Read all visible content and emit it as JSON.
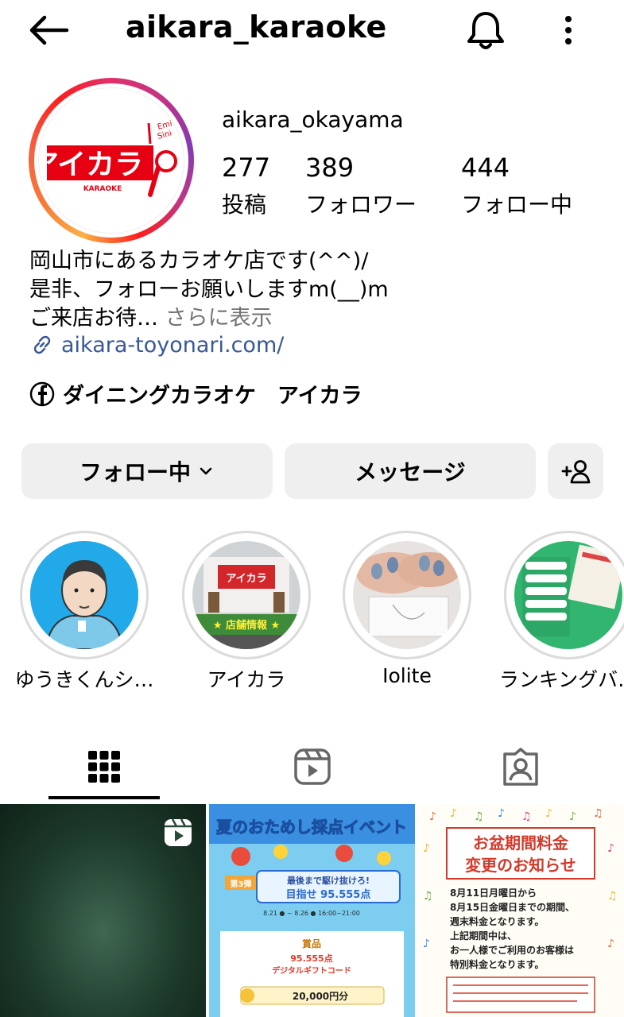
{
  "header": {
    "title": "aikara_karaoke",
    "back_icon": "arrow-left-icon",
    "bell_icon": "bell-icon",
    "more_icon": "more-vertical-icon"
  },
  "profile": {
    "avatar_logo_text": "アイカラ",
    "avatar_logo_sub": "KARAOKE",
    "display_name": "aikara_okayama",
    "stats": [
      {
        "num": "277",
        "label": "投稿"
      },
      {
        "num": "389",
        "label": "フォロワー"
      },
      {
        "num": "444",
        "label": "フォロー中"
      }
    ],
    "bio_line1": "岡山市にあるカラオケ店です(^^)/",
    "bio_line2": "是非、フォローお願いしますm(__)m",
    "bio_line3": "ご来店お待…",
    "bio_more": " さらに表示",
    "link": "aikara-toyonari.com/",
    "facebook": "ダイニングカラオケ　アイカラ"
  },
  "buttons": {
    "following": "フォロー中",
    "message": "メッセージ"
  },
  "highlights": [
    {
      "label": "ゆうきくんシ…"
    },
    {
      "label": "アイカラ",
      "sub": "★ 店舗情報 ★"
    },
    {
      "label": "Iolite"
    },
    {
      "label": "ランキングバ…"
    }
  ],
  "tabs": [
    "grid-icon",
    "reels-icon",
    "tagged-icon"
  ],
  "posts": [
    {
      "type": "reel"
    },
    {
      "title": "夏のおためし採点イベント",
      "badge": "第3弾",
      "headline": "最後まで駆け抜けろ!",
      "target": "目指せ 95.555点",
      "dates": "8.21 ● ~ 8.26 ● 16:00~21:00",
      "prize_title": "賞品",
      "prize_text": "95.555点",
      "gift": "デジタルギフトコード",
      "amount": "20,000円分"
    },
    {
      "title1": "お盆期間料金",
      "title2": "変更のお知らせ",
      "line1": "8月11日月曜日から",
      "line2": "8月15日金曜日までの期間、",
      "line3": "週末料金となります。",
      "line4": "上記期間中は、",
      "line5": "お一人様でご利用のお客様は",
      "line6": "特別料金となります。"
    }
  ],
  "colors": {
    "accent_link": "#385898",
    "button_bg": "#efefef",
    "muted": "#737373"
  }
}
